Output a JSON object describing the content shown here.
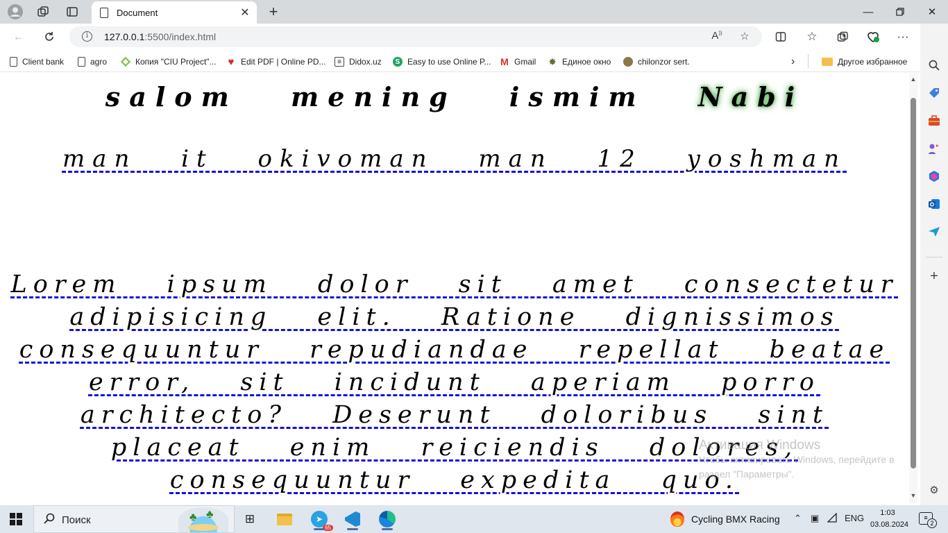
{
  "browser": {
    "tab_title": "Document",
    "url_host": "127.0.0.1",
    "url_path": ":5500/index.html",
    "favorites": [
      {
        "label": "Client bank",
        "icon": "document-icon"
      },
      {
        "label": "agro",
        "icon": "document-icon"
      },
      {
        "label": "Копия \"CIU Project\"...",
        "icon": "diamond-icon"
      },
      {
        "label": "Edit PDF | Online PD...",
        "icon": "heart-icon"
      },
      {
        "label": "Didox.uz",
        "icon": "grid-icon"
      },
      {
        "label": "Easy to use Online P...",
        "icon": "s-logo-icon"
      },
      {
        "label": "Gmail",
        "icon": "gmail-icon"
      },
      {
        "label": "Единое окно",
        "icon": "emblem-icon"
      },
      {
        "label": "chilonzor sert.",
        "icon": "seal-icon"
      }
    ],
    "other_favorites": "Другое избранное"
  },
  "page": {
    "heading_part1": "salom mening ismim",
    "heading_name": "Nabi",
    "subtitle": "man it okivoman man 12 yoshman",
    "paragraph": "Lorem ipsum dolor sit amet consectetur adipisicing elit. Ratione dignissimos consequuntur repudiandae repellat beatae error, sit incidunt aperiam porro architecto? Deserunt doloribus sint placeat enim reiciendis dolores, consequuntur expedita quo.",
    "underline_color": "#1010e0",
    "glow_color": "#3da53d"
  },
  "watermark": {
    "title": "Активация Windows",
    "line1": "Чтобы активировать Windows, перейдите в",
    "line2": "раздел \"Параметры\"."
  },
  "taskbar": {
    "search_placeholder": "Поиск",
    "telegram_badge": "65",
    "weather_label": "Cycling BMX Racing",
    "language": "ENG",
    "time": "1:03",
    "date": "03.08.2024",
    "notification_count": "2"
  }
}
